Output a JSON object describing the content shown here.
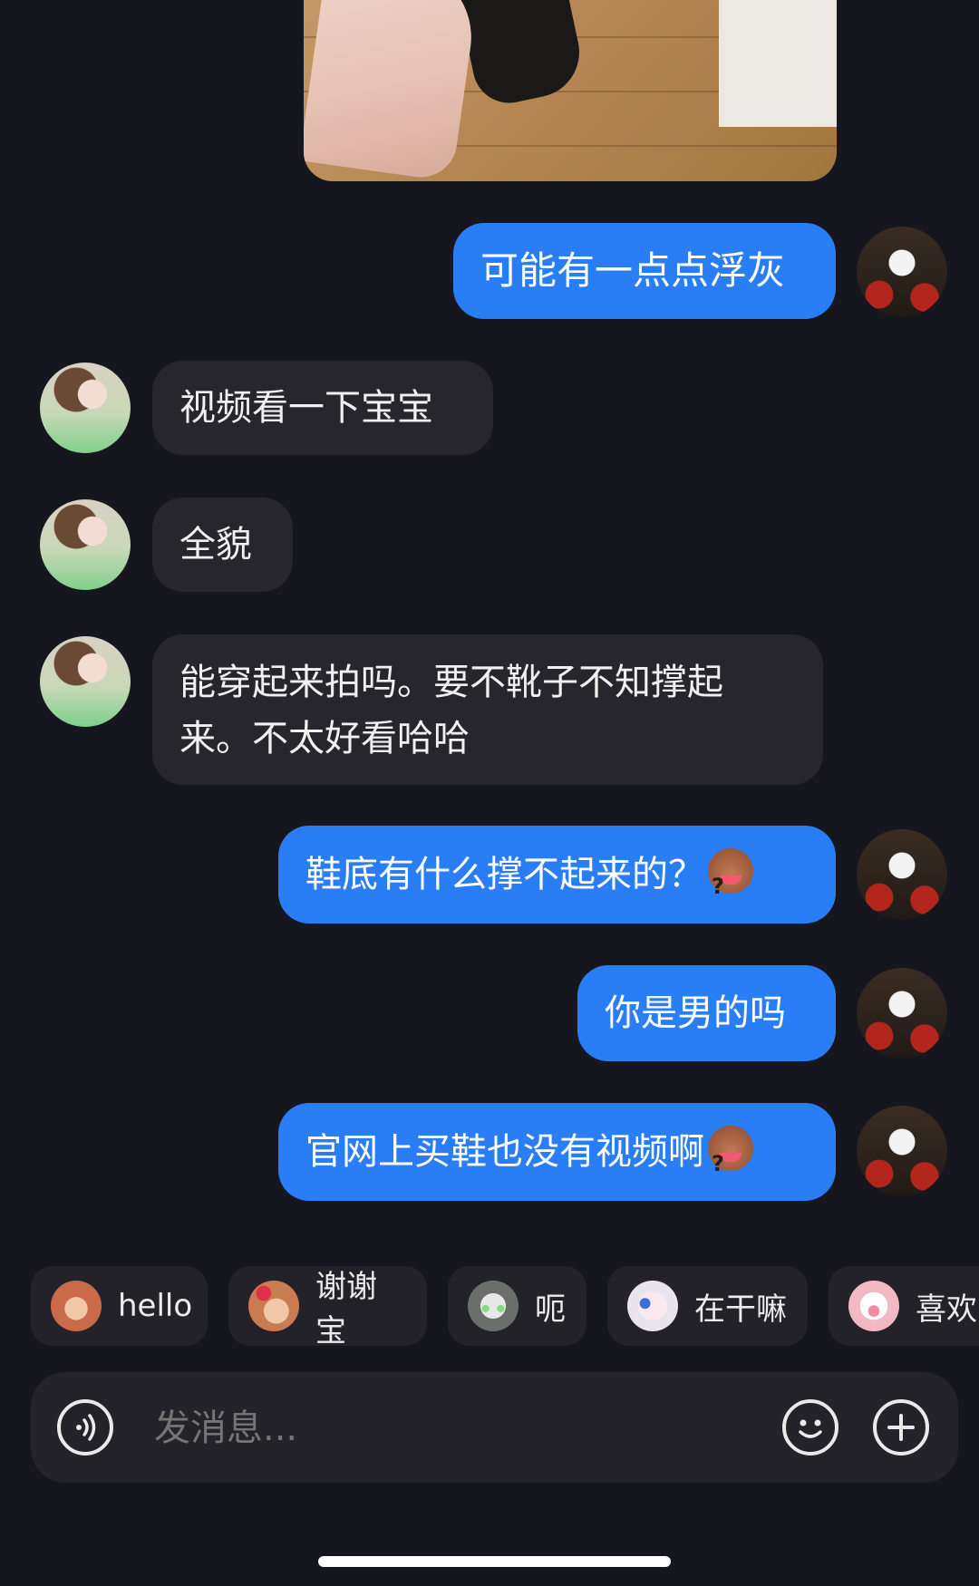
{
  "messages": [
    {
      "side": "me",
      "text": "可能有一点点浮灰",
      "emoji": ""
    },
    {
      "side": "her",
      "text": "视频看一下宝宝"
    },
    {
      "side": "her",
      "text": "全貌"
    },
    {
      "side": "her",
      "line1": "能穿起来拍吗。要不靴子不知撑起",
      "line2": "来。不太好看哈哈"
    },
    {
      "side": "me",
      "text": "鞋底有什么撑不起来的？",
      "emoji": "question-face-emoji"
    },
    {
      "side": "me",
      "text": "你是男的吗",
      "emoji": ""
    },
    {
      "side": "me",
      "text": "官网上买鞋也没有视频啊",
      "emoji": "question-face-emoji"
    }
  ],
  "quick_replies": [
    {
      "label": "hello",
      "icon": "waving-monkey-icon",
      "color": "#c96a4a"
    },
    {
      "label": "谢谢宝",
      "icon": "monkey-with-flower-icon",
      "color": "#c97b52"
    },
    {
      "label": "呃",
      "icon": "gray-cat-icon",
      "color": "#8a8f8a"
    },
    {
      "label": "在干嘛",
      "icon": "peeking-character-icon",
      "color": "#e9e4f0"
    },
    {
      "label": "喜欢",
      "icon": "pink-pig-icon",
      "color": "#f2b8c3"
    }
  ],
  "input": {
    "placeholder": "发消息...",
    "voice_icon": "voice-icon",
    "emoji_icon": "smiley-icon",
    "plus_icon": "plus-icon"
  },
  "colors": {
    "background": "#16161e",
    "my_bubble": "#2a7ef5",
    "her_bubble": "#26262c"
  }
}
